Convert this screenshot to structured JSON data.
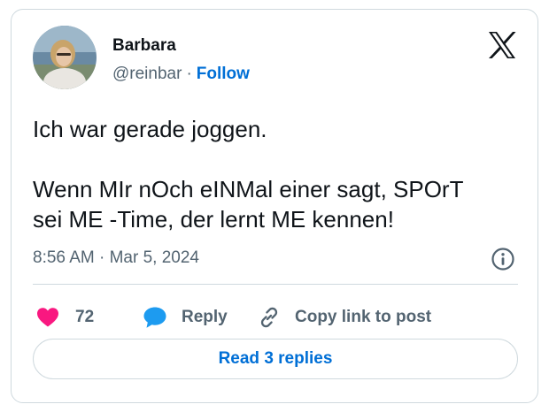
{
  "author": {
    "name": "Barbara",
    "handle": "@reinbar",
    "separator": "·",
    "follow_label": "Follow"
  },
  "tweet": {
    "line1": "Ich war gerade joggen.",
    "line2": "Wenn MIr nOch eINMal einer sagt, SPOrT",
    "line3": "sei ME -Time, der lernt ME kennen!"
  },
  "timestamp": "8:56 AM · Mar 5, 2024",
  "actions": {
    "likes_count": "72",
    "reply_label": "Reply",
    "copy_label": "Copy link to post"
  },
  "read_replies_label": "Read 3 replies",
  "colors": {
    "like": "#f91880",
    "reply": "#1d9bf0",
    "link": "#006fd6",
    "secondary_text": "#536471",
    "border": "#cfd9de"
  },
  "icons": {
    "brand": "x-logo-icon",
    "like": "heart-icon",
    "reply": "speech-bubble-icon",
    "copy": "link-icon",
    "info": "info-icon"
  }
}
